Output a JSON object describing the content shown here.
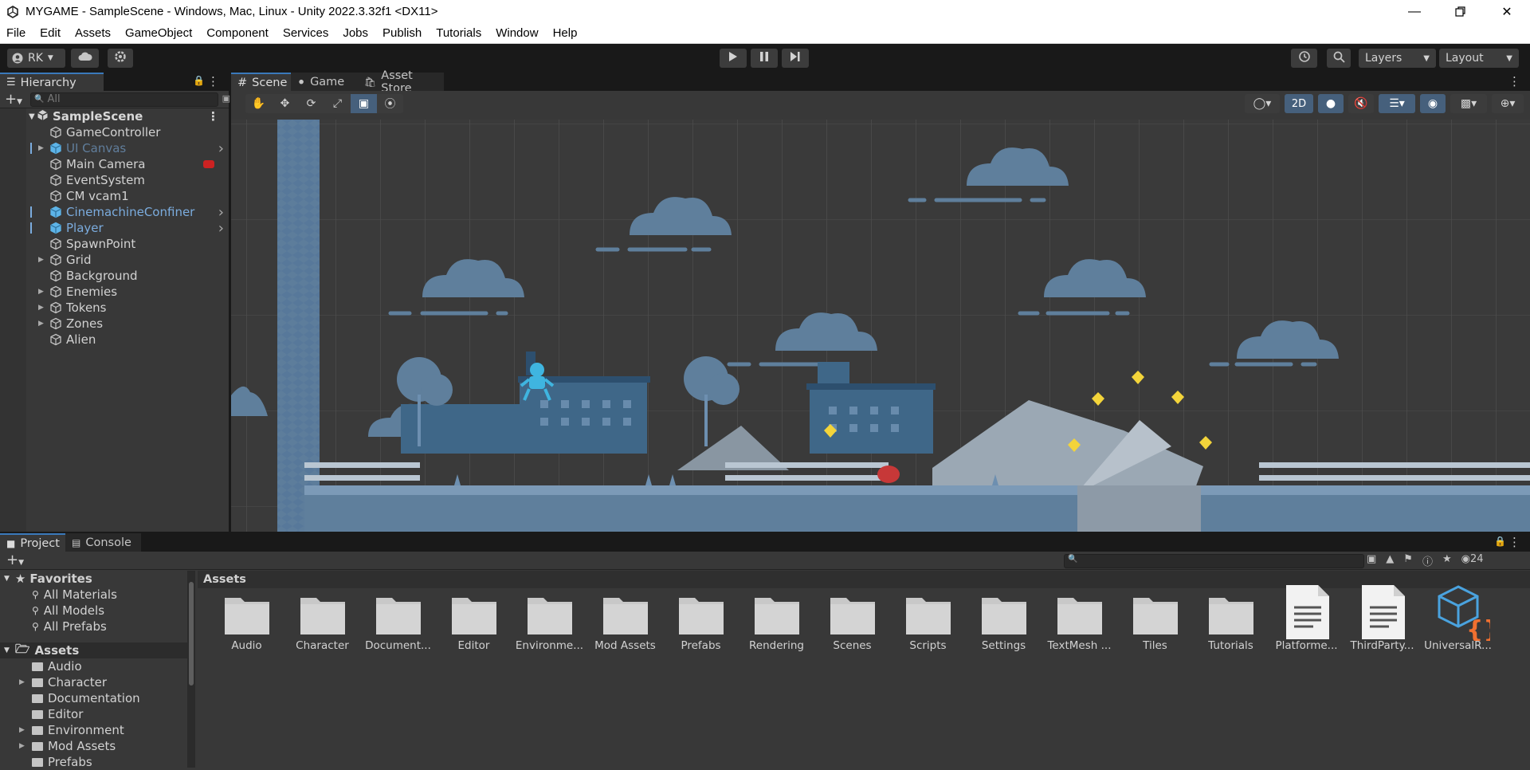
{
  "window": {
    "title": "MYGAME - SampleScene - Windows, Mac, Linux - Unity 2022.3.32f1 <DX11>"
  },
  "menu": [
    "File",
    "Edit",
    "Assets",
    "GameObject",
    "Component",
    "Services",
    "Jobs",
    "Publish",
    "Tutorials",
    "Window",
    "Help"
  ],
  "toolbar": {
    "account": "RK",
    "layers": "Layers",
    "layout": "Layout"
  },
  "hierarchy": {
    "tab": "Hierarchy",
    "search_placeholder": "All",
    "scene": "SampleScene",
    "items": [
      {
        "label": "GameController",
        "expandable": false,
        "prefab": false
      },
      {
        "label": "UI Canvas",
        "expandable": true,
        "prefab": true,
        "disabled": true
      },
      {
        "label": "Main Camera",
        "expandable": false,
        "prefab": false
      },
      {
        "label": "EventSystem",
        "expandable": false,
        "prefab": false
      },
      {
        "label": "CM vcam1",
        "expandable": false,
        "prefab": false
      },
      {
        "label": "CinemachineConfiner",
        "expandable": false,
        "prefab": true
      },
      {
        "label": "Player",
        "expandable": false,
        "prefab": true
      },
      {
        "label": "SpawnPoint",
        "expandable": false,
        "prefab": false
      },
      {
        "label": "Grid",
        "expandable": true,
        "prefab": false
      },
      {
        "label": "Background",
        "expandable": false,
        "prefab": false
      },
      {
        "label": "Enemies",
        "expandable": true,
        "prefab": false
      },
      {
        "label": "Tokens",
        "expandable": true,
        "prefab": false
      },
      {
        "label": "Zones",
        "expandable": true,
        "prefab": false
      },
      {
        "label": "Alien",
        "expandable": false,
        "prefab": false
      }
    ]
  },
  "scene_tabs": [
    "Scene",
    "Game",
    "Asset Store"
  ],
  "scene_toolbar": {
    "mode_2d": "2D"
  },
  "project": {
    "tabs": [
      "Project",
      "Console"
    ],
    "hidden_count": "24",
    "breadcrumb": "Assets",
    "favorites": {
      "label": "Favorites",
      "items": [
        "All Materials",
        "All Models",
        "All Prefabs"
      ]
    },
    "assets_root": "Assets",
    "tree": [
      {
        "label": "Audio",
        "expandable": false
      },
      {
        "label": "Character",
        "expandable": true
      },
      {
        "label": "Documentation",
        "expandable": false
      },
      {
        "label": "Editor",
        "expandable": false
      },
      {
        "label": "Environment",
        "expandable": true
      },
      {
        "label": "Mod Assets",
        "expandable": true
      },
      {
        "label": "Prefabs",
        "expandable": false
      }
    ],
    "assets": [
      {
        "label": "Audio",
        "kind": "folder"
      },
      {
        "label": "Character",
        "kind": "folder"
      },
      {
        "label": "Document...",
        "kind": "folder"
      },
      {
        "label": "Editor",
        "kind": "folder"
      },
      {
        "label": "Environme...",
        "kind": "folder"
      },
      {
        "label": "Mod Assets",
        "kind": "folder"
      },
      {
        "label": "Prefabs",
        "kind": "folder"
      },
      {
        "label": "Rendering",
        "kind": "folder"
      },
      {
        "label": "Scenes",
        "kind": "folder"
      },
      {
        "label": "Scripts",
        "kind": "folder"
      },
      {
        "label": "Settings",
        "kind": "folder"
      },
      {
        "label": "TextMesh ...",
        "kind": "folder"
      },
      {
        "label": "Tiles",
        "kind": "folder"
      },
      {
        "label": "Tutorials",
        "kind": "folder"
      },
      {
        "label": "Platforme...",
        "kind": "document"
      },
      {
        "label": "ThirdParty...",
        "kind": "document"
      },
      {
        "label": "UniversalR...",
        "kind": "package"
      }
    ]
  },
  "colors": {
    "accent": "#3a79bb",
    "prefab_blue": "#7bacde",
    "panel": "#383838",
    "dark": "#191919"
  }
}
